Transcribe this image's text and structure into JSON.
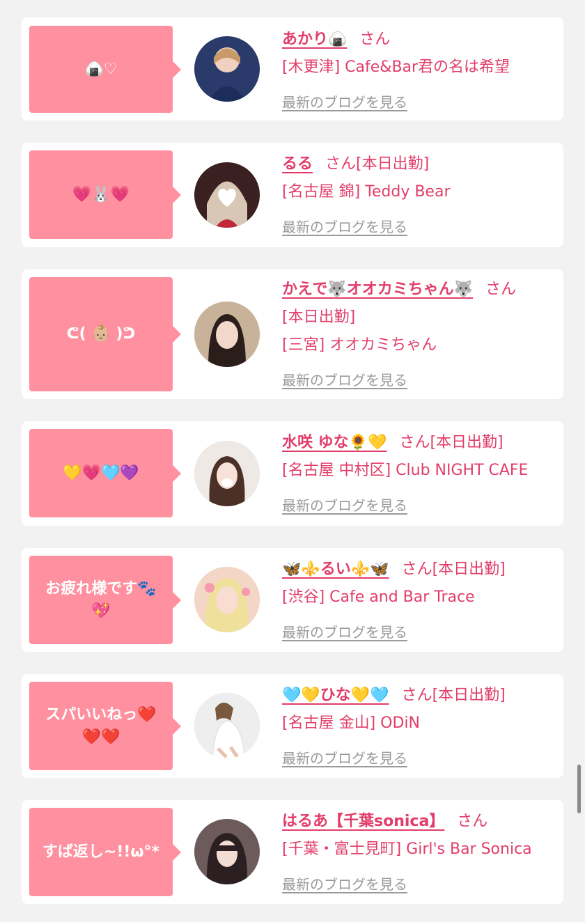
{
  "entries": [
    {
      "bubble": "🍙♡",
      "name": "あかり🍙",
      "san": "さん",
      "status": "",
      "shop": "[木更津] Cafe&Bar君の名は希望",
      "blog": "最新のブログを見る",
      "avatar_color": "#2a3a6a"
    },
    {
      "bubble": "💗🐰💗",
      "name": "るる",
      "san": "さん",
      "status": "[本日出勤]",
      "shop": "[名古屋 錦] Teddy Bear",
      "blog": "最新のブログを見る",
      "avatar_color": "#3a2020"
    },
    {
      "bubble": "ᕦ( 👶🏼 )ᕤ",
      "name": "かえで🐺オオカミちゃん🐺",
      "san": "さん",
      "status": "[本日出勤]",
      "shop": "[三宮] オオカミちゃん",
      "blog": "最新のブログを見る",
      "avatar_color": "#c8b39a"
    },
    {
      "bubble": "💛💗🩵💜",
      "name": "水咲 ゆな🌻💛",
      "san": "さん",
      "status": "[本日出勤]",
      "shop": "[名古屋 中村区] Club NIGHT CAFE",
      "blog": "最新のブログを見る",
      "avatar_color": "#efe9e6"
    },
    {
      "bubble": "お疲れ様です🐾💖",
      "name": "🦋⚜️るい⚜️🦋",
      "san": "さん",
      "status": "[本日出勤]",
      "shop": "[渋谷] Cafe and Bar Trace",
      "blog": "最新のブログを見る",
      "avatar_color": "#f3d6c6"
    },
    {
      "bubble": "スパいいねっ❤️❤️❤️",
      "name": "🩵💛ひな💛🩵",
      "san": "さん",
      "status": "[本日出勤]",
      "shop": "[名古屋 金山] ODiN",
      "blog": "最新のブログを見る",
      "avatar_color": "#eeeeee"
    },
    {
      "bubble": "すば返し~!!ω°*",
      "name": "はるあ【千葉sonica】",
      "san": "さん",
      "status": "",
      "shop": "[千葉・富士見町] Girl's Bar Sonica",
      "blog": "最新のブログを見る",
      "avatar_color": "#6d5a5a"
    }
  ],
  "colors": {
    "bubble": "#ff909f",
    "accent": "#e23d6a",
    "link_gray": "#9a9a9a",
    "background": "#f2f2f2"
  }
}
